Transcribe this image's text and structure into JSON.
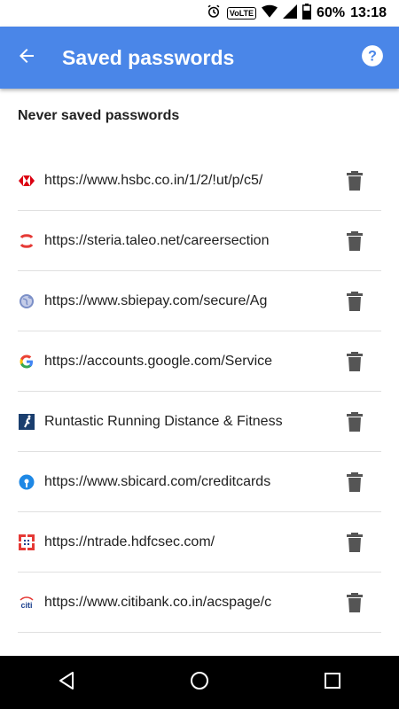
{
  "status_bar": {
    "volte_label": "VoLTE",
    "battery_percent": "60%",
    "time": "13:18"
  },
  "app_bar": {
    "title": "Saved passwords",
    "color": "#4a86e8"
  },
  "section_header": "Never saved passwords",
  "entries": [
    {
      "text": "https://www.hsbc.co.in/1/2/!ut/p/c5/",
      "icon": "hsbc-icon"
    },
    {
      "text": "https://steria.taleo.net/careersection",
      "icon": "taleo-icon"
    },
    {
      "text": "https://www.sbiepay.com/secure/Ag",
      "icon": "globe-icon"
    },
    {
      "text": "https://accounts.google.com/Service",
      "icon": "google-icon"
    },
    {
      "text": "Runtastic Running Distance & Fitness",
      "icon": "runtastic-icon"
    },
    {
      "text": "https://www.sbicard.com/creditcards",
      "icon": "sbi-icon"
    },
    {
      "text": "https://ntrade.hdfcsec.com/",
      "icon": "hdfc-icon"
    },
    {
      "text": "https://www.citibank.co.in/acspage/c",
      "icon": "citi-icon"
    }
  ]
}
